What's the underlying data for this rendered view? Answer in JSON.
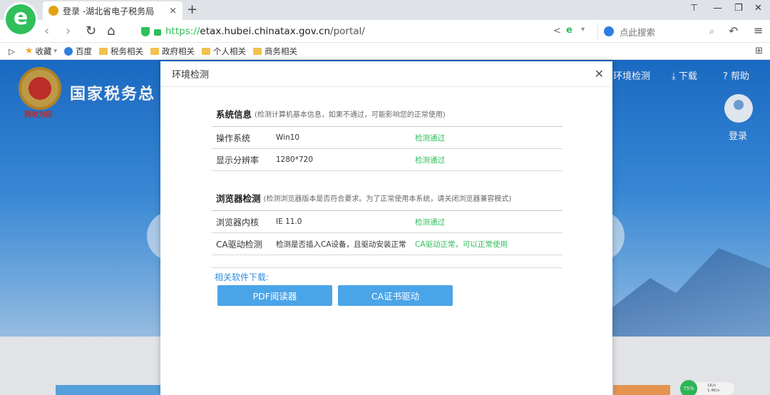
{
  "browser": {
    "logo_letter": "e",
    "tab_title": "登录 -湖北省电子税务局",
    "tab_close": "×",
    "new_tab": "+",
    "url": {
      "scheme": "https://",
      "host": "etax.hubei.chinatax.gov.cn",
      "path": "/portal/"
    },
    "search_placeholder": "点此搜索",
    "accent": "#2fbf5b",
    "icons": {
      "back": "‹",
      "forward": "›",
      "refresh": "↻",
      "home": "⌂",
      "share": "<",
      "search": "⌕",
      "undo": "↶",
      "menu": "≡",
      "grid": "⊞",
      "min": "—",
      "max": "❐",
      "close": "✕",
      "skin": "⊤"
    }
  },
  "bookmarks": {
    "toggle": "▷",
    "items": [
      {
        "label": "收藏",
        "icon": "star-icon"
      },
      {
        "label": "百度",
        "icon": "baidu-icon"
      },
      {
        "label": "税务相关",
        "icon": "folder-icon"
      },
      {
        "label": "政府相关",
        "icon": "folder-icon"
      },
      {
        "label": "个人相关",
        "icon": "folder-icon"
      },
      {
        "label": "商务相关",
        "icon": "folder-icon"
      }
    ]
  },
  "site": {
    "name": "国家税务总",
    "motto": "税收为民",
    "nav": {
      "env_check": "环境检测",
      "download": "下载",
      "help": "帮助"
    },
    "login": "登录"
  },
  "dialog": {
    "title": "环境检测",
    "close": "✕",
    "system": {
      "title": "系统信息",
      "note": "(检测计算机基本信息，如果不通过，可能影响您的正常使用)",
      "rows": [
        {
          "name": "操作系统",
          "value": "Win10",
          "status": "检测通过"
        },
        {
          "name": "显示分辨率",
          "value": "1280*720",
          "status": "检测通过"
        }
      ]
    },
    "browser": {
      "title": "浏览器检测",
      "note": "(检测浏览器版本是否符合要求。为了正常使用本系统，请关闭浏览器兼容模式)",
      "rows": [
        {
          "name": "浏览器内核",
          "value": "IE 11.0",
          "status": "检测通过"
        },
        {
          "name": "CA驱动检测",
          "value": "检测是否插入CA设备，且驱动安装正常",
          "status": "CA驱动正常，可以正常使用"
        }
      ]
    },
    "downloads": {
      "title": "相关软件下载:",
      "buttons": [
        "PDF阅读器",
        "CA证书驱动"
      ]
    },
    "status_color": "#2fbf5b",
    "button_color": "#4aa4e8"
  },
  "tray": {
    "percent": "75%",
    "up": "1K/s",
    "down": "1.4K/s"
  }
}
